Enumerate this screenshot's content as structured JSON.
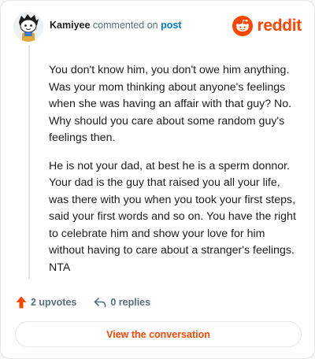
{
  "header": {
    "username": "Kamiyee",
    "action_text": "commented on",
    "target_link": "post",
    "brand_name": "reddit"
  },
  "comment": {
    "paragraphs": [
      "You don't know him, you don't owe him anything. Was your mom thinking about anyone's feelings when she was having an affair with that guy? No. Why should you care about some random guy's feelings then.",
      "He is not your dad, at best he is a sperm donnor. Your dad is the guy that raised you all your life, was there with you when you took your first steps, said your first words and so on. You have the right to celebrate him and show your love for him without having to care about a stranger's feelings. NTA"
    ]
  },
  "actions": {
    "upvotes_label": "2 upvotes",
    "replies_label": "0 replies"
  },
  "cta": {
    "label": "View the conversation"
  },
  "colors": {
    "brand": "#ff4500",
    "link": "#0079d3",
    "text": "#1c1c1c",
    "muted": "#576f76"
  },
  "icons": [
    "avatar",
    "reddit-logo-icon",
    "upvote-arrow-icon",
    "reply-icon"
  ]
}
